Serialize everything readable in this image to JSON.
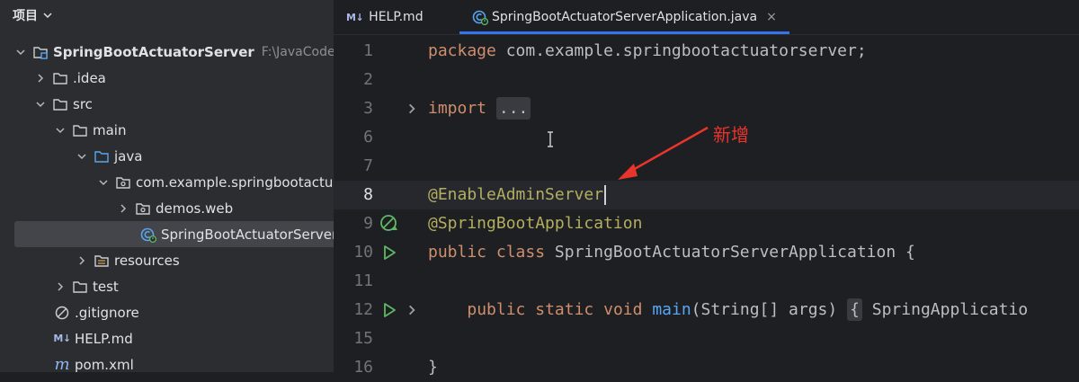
{
  "project_panel": {
    "title": "项目",
    "tree": [
      {
        "label": "SpringBootActuatorServer",
        "path": "F:\\JavaCode\\Spr",
        "icon": "module-folder-icon"
      },
      {
        "label": ".idea",
        "icon": "folder-icon"
      },
      {
        "label": "src",
        "icon": "folder-icon"
      },
      {
        "label": "main",
        "icon": "folder-icon"
      },
      {
        "label": "java",
        "icon": "source-folder-icon"
      },
      {
        "label": "com.example.springbootactuat",
        "icon": "package-icon"
      },
      {
        "label": "demos.web",
        "icon": "package-icon"
      },
      {
        "label": "SpringBootActuatorServerA",
        "icon": "spring-boot-class-icon"
      },
      {
        "label": "resources",
        "icon": "resources-folder-icon"
      },
      {
        "label": "test",
        "icon": "folder-icon"
      },
      {
        "label": ".gitignore",
        "icon": "gitignore-icon"
      },
      {
        "label": "HELP.md",
        "badge": "M↓",
        "icon": "markdown-icon"
      },
      {
        "label": "pom.xml",
        "badge": "m",
        "icon": "maven-icon"
      }
    ]
  },
  "editor": {
    "tabs": [
      {
        "label": "HELP.md",
        "badge": "M↓",
        "icon": "markdown-icon"
      },
      {
        "label": "SpringBootActuatorServerApplication.java",
        "icon": "spring-boot-class-icon",
        "close": "×"
      }
    ],
    "line_numbers": [
      "1",
      "2",
      "3",
      "6",
      "7",
      "8",
      "9",
      "10",
      "11",
      "12",
      "15",
      "16"
    ],
    "code": {
      "l1_kw": "package",
      "l1_rest": " com.example.springbootactuatorserver;",
      "l3_kw": "import",
      "l3_fold": "...",
      "l8_ann": "@EnableAdminServer",
      "l9_ann": "@SpringBootApplication",
      "l10_kw1": "public",
      "l10_kw2": "class",
      "l10_rest": " SpringBootActuatorServerApplication {",
      "l12_kw1": "public",
      "l12_kw2": "static",
      "l12_kw3": "void",
      "l12_fn": "main",
      "l12_args": "(String[] args)",
      "l12_fold": "{",
      "l12_rest": " SpringApplicatio",
      "l16": "}"
    },
    "annotation": "新增"
  },
  "colors": {
    "keyword": "#cf8e6d",
    "annotation": "#b3ae60",
    "function": "#56a8f5",
    "arrow": "#e8352c",
    "run": "#5fb865",
    "tab_accent": "#3574f0"
  }
}
